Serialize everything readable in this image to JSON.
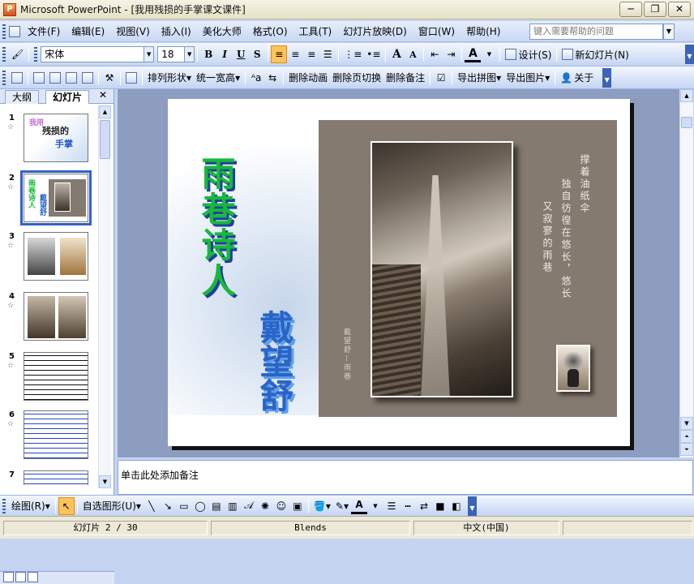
{
  "window": {
    "title": "Microsoft PowerPoint - [我用残损的手掌课文课件]",
    "minimize": "─",
    "restore": "❐",
    "close": "✕"
  },
  "menu": {
    "items": [
      "文件(F)",
      "编辑(E)",
      "视图(V)",
      "插入(I)",
      "美化大师",
      "格式(O)",
      "工具(T)",
      "幻灯片放映(D)",
      "窗口(W)",
      "帮助(H)"
    ],
    "help_placeholder": "键入需要帮助的问题"
  },
  "format_toolbar": {
    "font": "宋体",
    "size": "18",
    "bold": "B",
    "italic": "I",
    "underline": "U",
    "shadow": "S",
    "grow_font": "A",
    "shrink_font": "A",
    "font_color": "A",
    "design": "设计(S)",
    "new_slide": "新幻灯片(N)"
  },
  "beautify_toolbar": {
    "arrange": "排列形状",
    "uniform": "统一宽高",
    "delete_anim": "删除动画",
    "delete_transition": "删除页切换",
    "delete_notes": "删除备注",
    "export_collage": "导出拼图",
    "export_images": "导出图片",
    "about": "关于"
  },
  "pane": {
    "tab_outline": "大纲",
    "tab_slides": "幻灯片",
    "close": "✕"
  },
  "thumbnails": [
    {
      "num": "1",
      "star": "☆",
      "line1": "我用",
      "line2": "残损的",
      "line3": "手掌"
    },
    {
      "num": "2",
      "star": "☆",
      "line1": "雨巷诗人",
      "line2": "戴望舒"
    },
    {
      "num": "3",
      "star": "☆"
    },
    {
      "num": "4",
      "star": "☆"
    },
    {
      "num": "5",
      "star": "☆"
    },
    {
      "num": "6",
      "star": "☆"
    },
    {
      "num": "7",
      "star": "☆"
    }
  ],
  "slide": {
    "title": "雨巷诗人",
    "author": "戴望舒",
    "poem_col1": "撑着油纸伞",
    "poem_col2": "独自彷徨在悠长，悠长",
    "poem_col3": "又寂寥的雨巷",
    "caption": "戴望舒—雨巷"
  },
  "notes": {
    "placeholder": "单击此处添加备注"
  },
  "drawing_toolbar": {
    "draw": "绘图(R)",
    "autoshapes": "自选图形(U)",
    "font_color": "A"
  },
  "status": {
    "slide": "幻灯片 2 / 30",
    "design": "Blends",
    "language": "中文(中国)"
  },
  "colors": {
    "accent": "#3163c5",
    "title_green": "#19b83a",
    "author_blue": "#2a64c8",
    "photo_frame": "#847a70"
  }
}
